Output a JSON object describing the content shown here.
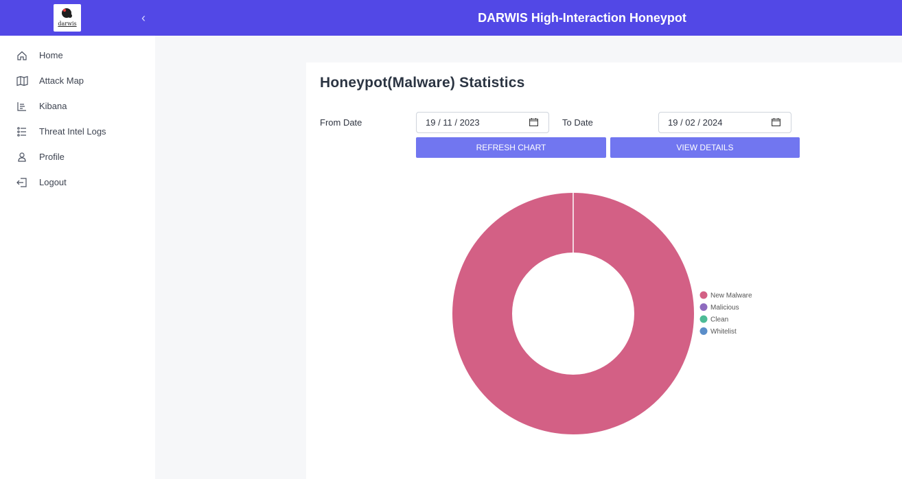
{
  "header": {
    "title": "DARWIS High-Interaction Honeypot",
    "logo_text": "darwis",
    "collapse_icon": "chevron-left-icon"
  },
  "sidebar": {
    "items": [
      {
        "label": "Home",
        "icon": "home-icon"
      },
      {
        "label": "Attack Map",
        "icon": "map-icon"
      },
      {
        "label": "Kibana",
        "icon": "kibana-icon"
      },
      {
        "label": "Threat Intel Logs",
        "icon": "list-icon"
      },
      {
        "label": "Profile",
        "icon": "user-icon"
      },
      {
        "label": "Logout",
        "icon": "logout-icon"
      }
    ]
  },
  "main": {
    "title": "Honeypot(Malware) Statistics",
    "from_label": "From Date",
    "from_value": "19 / 11 / 2023",
    "to_label": "To Date",
    "to_value": "19 / 02 / 2024",
    "refresh_button": "REFRESH CHART",
    "details_button": "VIEW DETAILS"
  },
  "colors": {
    "header_bg": "#5248e6",
    "button_bg": "#7176f0",
    "new_malware": "#d36085",
    "malicious": "#8e6bbf",
    "clean": "#4dbb96",
    "whitelist": "#5b8ec9"
  },
  "chart_data": {
    "type": "pie",
    "variant": "doughnut",
    "categories": [
      "New Malware",
      "Malicious",
      "Clean",
      "Whitelist"
    ],
    "values": [
      1,
      0,
      0,
      0
    ],
    "legend": "right",
    "colors": [
      "#d36085",
      "#8e6bbf",
      "#4dbb96",
      "#5b8ec9"
    ]
  }
}
